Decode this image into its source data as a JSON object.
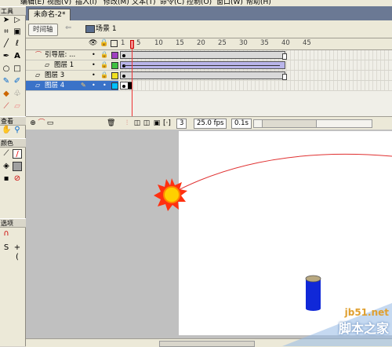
{
  "menu": {
    "items": [
      "编辑(E)",
      "视图(V)",
      "插入(I)",
      "修改(M)",
      "文本(T)",
      "命令(C)",
      "控制(O)",
      "窗口(W)",
      "帮助(H)"
    ]
  },
  "tools": {
    "header": "工具",
    "view_header": "查看",
    "colors_header": "颜色",
    "options_header": "选项"
  },
  "document": {
    "tab_title": "未命名-2*"
  },
  "scenebar": {
    "timeline_button": "时间轴",
    "scene_label": "场景 1"
  },
  "timeline": {
    "ruler_numbers": [
      "1",
      "5",
      "10",
      "15",
      "20",
      "25",
      "30",
      "35",
      "40",
      "45"
    ],
    "layers": [
      {
        "name": "引导层: ...",
        "type": "guide",
        "color": "#a040c0"
      },
      {
        "name": "图层 1",
        "type": "normal",
        "color": "#40c040"
      },
      {
        "name": "图层 3",
        "type": "normal",
        "color": "#f0e020"
      },
      {
        "name": "图层 4",
        "type": "normal",
        "color": "#00c0ff",
        "selected": true
      }
    ],
    "current_frame": "3",
    "fps": "25.0 fps",
    "elapsed": "0.1s"
  },
  "watermark": {
    "url": "jb51.net",
    "name": "脚本之家"
  },
  "colors": {
    "stage": "#ffffff",
    "workspace": "#c0c0c0",
    "guide_path": "#e03030",
    "sun": "#ff3010",
    "cylinder": "#1028d8"
  }
}
